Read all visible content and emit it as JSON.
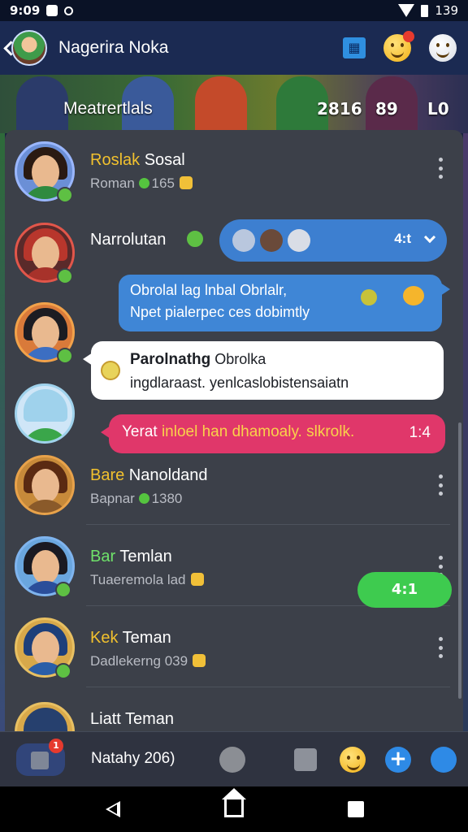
{
  "status_bar": {
    "time": "9:09",
    "battery": "139"
  },
  "header": {
    "title": "Nagerira Noka"
  },
  "banner": {
    "label": "Meatrertlals",
    "num1": "2816",
    "num2": "89",
    "num3": "L0"
  },
  "contacts": [
    {
      "name_highlight": "Roslak",
      "name_rest": " Sosal",
      "sub": "Roman",
      "count": "165",
      "avatar_hair": "#2a1a12",
      "avatar_body": "#2f8a3f",
      "avatar_bg": "#6b8fd6"
    },
    {
      "name_highlight": "",
      "name_rest": "Narrolutan",
      "sub": "",
      "count": "",
      "avatar_hair": "#b8362c",
      "avatar_body": "#a7322a",
      "avatar_bg": "#5a2a2a"
    },
    {
      "name_highlight": "",
      "name_rest": "",
      "sub": "",
      "count": "",
      "avatar_hair": "#1c1c22",
      "avatar_body": "#3c6ec2",
      "avatar_bg": "#d97a3a"
    },
    {
      "name_highlight": "",
      "name_rest": "",
      "sub": "",
      "count": "",
      "avatar_hair": "#9fd2ec",
      "avatar_body": "#3aa64a",
      "avatar_bg": "#cfe6f7"
    },
    {
      "name_highlight": "Bare",
      "name_rest": " Nanoldand",
      "sub": "Bapnar",
      "count": "1380",
      "avatar_hair": "#5a2a12",
      "avatar_body": "#8a5a2a",
      "avatar_bg": "#c78a3a"
    },
    {
      "name_highlight": "Bar",
      "name_rest": " Temlan",
      "sub": "Tuaeremola",
      "count": "",
      "sub_extra": "lad",
      "avatar_hair": "#1a1a22",
      "avatar_body": "#2a4e9a",
      "avatar_bg": "#6aa6de"
    },
    {
      "name_highlight": "Kek",
      "name_rest": " Teman",
      "sub": "Dadlekerng",
      "count": "",
      "sub_extra": "039",
      "avatar_hair": "#1d3f7a",
      "avatar_body": "#2a5ea8",
      "avatar_bg": "#d7a84a"
    },
    {
      "name_highlight": "",
      "name_rest": "Liatt Teman",
      "sub": "",
      "count": "",
      "avatar_hair": "#26406e",
      "avatar_body": "#1b2a4a",
      "avatar_bg": "#d9a94a"
    }
  ],
  "bubbles": {
    "pill_text": "4:t",
    "blue_line1": "Obrolal lag lnbal Obrlalr,",
    "blue_line2": "Npet pialerpec ces dobimtly",
    "white_title": "Parolnathg",
    "white_title_rest": " Obrolka",
    "white_line2": "ingdlaraast. yenlcaslobistensaiat",
    "white_line2_tail": "n",
    "pink_text": "Yerat ",
    "pink_highlight": "inloel han dhamoaly. slkrolk.",
    "pink_tail": "1:4"
  },
  "green_pill": {
    "label": "4:1"
  },
  "bottom_bar": {
    "label": "Natahy 206)",
    "badge": "1"
  },
  "colors": {
    "accent_blue": "#3f86d6",
    "pink": "#e0376a",
    "green": "#3ecb4f",
    "highlight_yellow": "#f2c12e"
  }
}
